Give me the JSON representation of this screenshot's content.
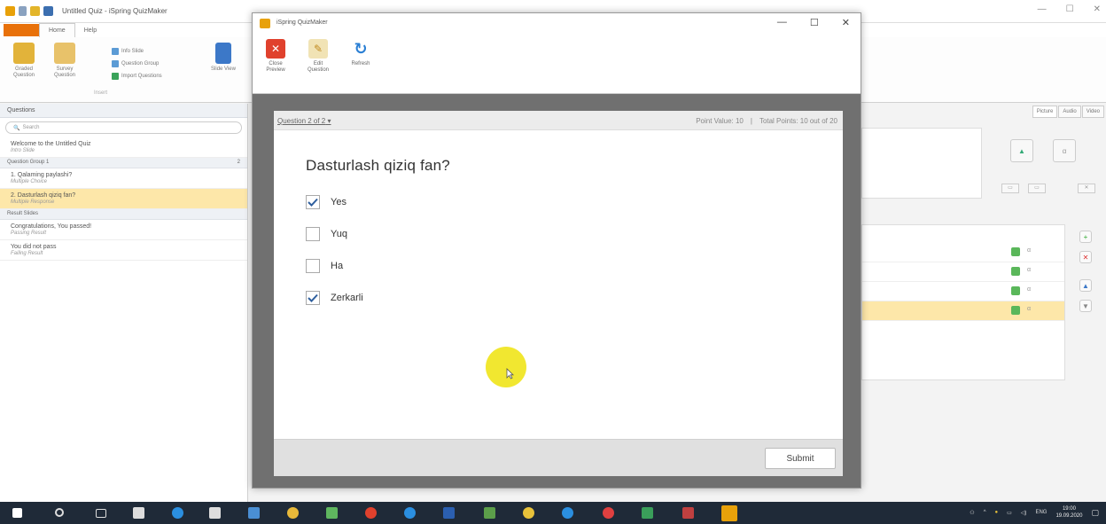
{
  "app": {
    "title": "Untitled Quiz - iSpring QuizMaker",
    "file_tab": "",
    "tabs": [
      "Home",
      "Help"
    ],
    "ribbon": {
      "graded": "Graded Question",
      "survey": "Survey Question",
      "info_slide": "Info Slide",
      "question_group": "Question Group",
      "import_questions": "Import Questions",
      "slide_view": "Slide View",
      "group_label": "Insert"
    }
  },
  "left_pane": {
    "header": "Questions",
    "search_placeholder": "Search",
    "intro": {
      "title": "Welcome to the Untitled Quiz",
      "sub": "Intro Slide"
    },
    "group1": {
      "label": "Question Group 1",
      "count": "2"
    },
    "questions": [
      {
        "title": "1. Qalaming paylashi?",
        "sub": "Multiple Choice"
      },
      {
        "title": "2. Dasturlash qiziq fan?",
        "sub": "Multiple Response"
      }
    ],
    "result_group": "Result Slides",
    "results": [
      {
        "title": "Congratulations, You passed!",
        "sub": "Passing Result"
      },
      {
        "title": "You did not pass",
        "sub": "Failing Result"
      }
    ]
  },
  "right_pane": {
    "tabs": [
      "Picture",
      "Audio",
      "Video"
    ]
  },
  "dialog": {
    "title": "iSpring QuizMaker",
    "toolbar": {
      "close_preview": "Close Preview",
      "edit_question": "Edit Question",
      "refresh": "Refresh"
    }
  },
  "player": {
    "nav": "Question 2 of 2",
    "point_value": "Point Value: 10",
    "total_points": "Total Points: 10 out of 20",
    "question": "Dasturlash qiziq fan?",
    "options": [
      {
        "label": "Yes",
        "checked": true
      },
      {
        "label": "Yuq",
        "checked": false
      },
      {
        "label": "Ha",
        "checked": false
      },
      {
        "label": "Zerkarli",
        "checked": true
      }
    ],
    "submit": "Submit"
  },
  "taskbar": {
    "lang": "ENG",
    "time": "19:00",
    "date": "19.09.2020"
  },
  "colors": {
    "accent_orange": "#e8710a",
    "selected_row": "#fde7a9",
    "checkbox_check": "#2f5f9e",
    "cursor_highlight": "#f0e41a"
  }
}
